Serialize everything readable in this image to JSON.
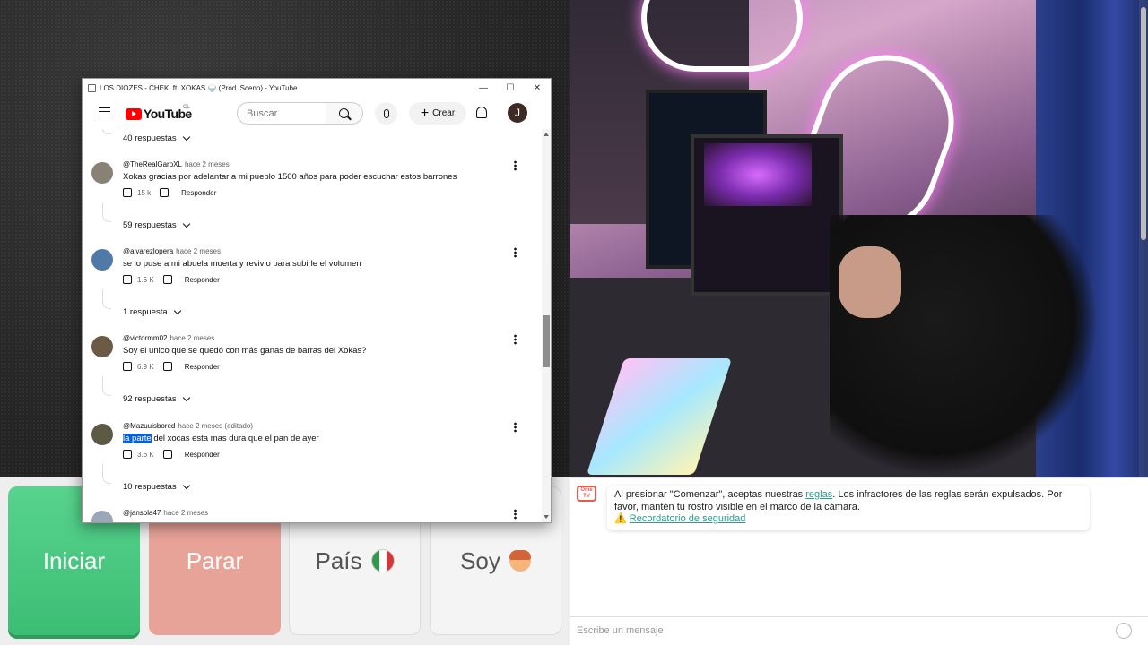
{
  "window": {
    "title": "LOS DIOZES - CHEKI ft. XOKAS 🍚 (Prod. Sceno) - YouTube",
    "minimize": "—",
    "maximize": "☐",
    "close": "✕"
  },
  "youtube": {
    "logo_text": "YouTube",
    "country_code": "CL",
    "search_placeholder": "Buscar",
    "create_label": "Crear",
    "create_plus": "+",
    "avatar_letter": "J"
  },
  "comments": {
    "top_replies": "40 respuestas",
    "items": [
      {
        "author": "@TheRealGaroXL",
        "time": "hace 2 meses",
        "text": "Xokas gracias por adelantar a mi pueblo 1500 años para poder escuchar estos barrones",
        "likes": "15 k",
        "reply_label": "Responder",
        "replies": "59 respuestas"
      },
      {
        "author": "@alvarezlopera",
        "time": "hace 2 meses",
        "text": "se lo puse a mi abuela muerta y revivio para subirle el volumen",
        "likes": "1.6 K",
        "reply_label": "Responder",
        "replies": "1 respuesta"
      },
      {
        "author": "@victormm02",
        "time": "hace 2 meses",
        "text": "Soy el unico que se quedó con más ganas de barras del Xokas?",
        "likes": "6.9 K",
        "reply_label": "Responder",
        "replies": "92 respuestas"
      },
      {
        "author": "@Mazuuisbored",
        "time": "hace 2 meses (editado)",
        "text_highlight": "la parte",
        "text_rest": " del xocas esta mas dura que el pan de ayer",
        "likes": "3.6 K",
        "reply_label": "Responder",
        "replies": "10 respuestas"
      },
      {
        "author": "@jansola47",
        "time": "hace 2 meses"
      }
    ]
  },
  "controls": {
    "start": "Iniciar",
    "stop": "Parar",
    "country": "País",
    "gender": "Soy"
  },
  "chat": {
    "notice_logo": "Ome TV",
    "notice_before": "Al presionar \"Comenzar\", aceptas nuestras ",
    "notice_link": "reglas",
    "notice_after": ". Los infractores de las reglas serán expulsados. Por favor, mantén tu rostro visible en el marco de la cámara.",
    "warning_icon": "⚠️",
    "safety_link": "Recordatorio de seguridad",
    "input_placeholder": "Escribe un mensaje"
  },
  "colors": {
    "start": "#3cbd74",
    "stop": "#e8a399",
    "youtube_red": "#ff0000",
    "link": "#2a9d8f"
  }
}
